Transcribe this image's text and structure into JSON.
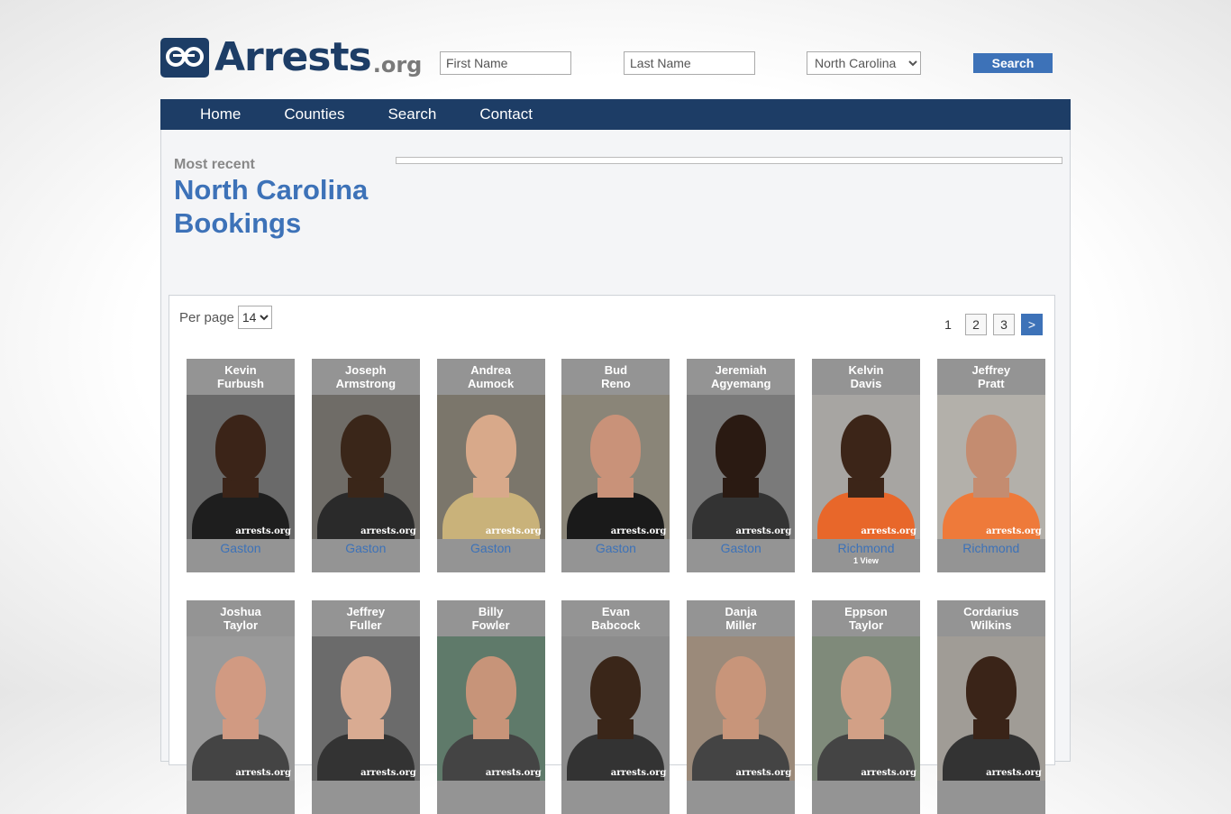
{
  "logo": {
    "text": "Arrests",
    "suffix": ".org"
  },
  "search": {
    "first_placeholder": "First Name",
    "last_placeholder": "Last Name",
    "state_selected": "North Carolina",
    "button_label": "Search"
  },
  "nav": [
    "Home",
    "Counties",
    "Search",
    "Contact"
  ],
  "heading": {
    "eyebrow": "Most recent",
    "title_line1": "North Carolina",
    "title_line2": "Bookings"
  },
  "list": {
    "per_page_label": "Per page",
    "per_page_value": "14",
    "pages": {
      "current": "1",
      "p2": "2",
      "p3": "3",
      "next": ">"
    },
    "watermark": "arrests.org",
    "bookings": [
      {
        "first": "Kevin",
        "last": "Furbush",
        "county": "Gaston",
        "views": "",
        "bg": "#6a6a6a",
        "skin": "#3b2418",
        "shirt": "#1e1e1e"
      },
      {
        "first": "Joseph",
        "last": "Armstrong",
        "county": "Gaston",
        "views": "",
        "bg": "#6f6c67",
        "skin": "#3a2619",
        "shirt": "#2a2a2a"
      },
      {
        "first": "Andrea",
        "last": "Aumock",
        "county": "Gaston",
        "views": "",
        "bg": "#7b766b",
        "skin": "#d8a98a",
        "shirt": "#c9b27a"
      },
      {
        "first": "Bud",
        "last": "Reno",
        "county": "Gaston",
        "views": "",
        "bg": "#8a8578",
        "skin": "#c99279",
        "shirt": "#1a1a1a"
      },
      {
        "first": "Jeremiah",
        "last": "Agyemang",
        "county": "Gaston",
        "views": "",
        "bg": "#7a7a7a",
        "skin": "#2a1a12",
        "shirt": "#333333"
      },
      {
        "first": "Kelvin",
        "last": "Davis",
        "county": "Richmond",
        "views": "1 View",
        "bg": "#a7a5a2",
        "skin": "#3c2518",
        "shirt": "#e8672a"
      },
      {
        "first": "Jeffrey",
        "last": "Pratt",
        "county": "Richmond",
        "views": "",
        "bg": "#b3b0aa",
        "skin": "#c48c70",
        "shirt": "#ee7a3a"
      },
      {
        "first": "Joshua",
        "last": "Taylor",
        "county": "",
        "views": "",
        "bg": "#9a9a9a",
        "skin": "#d19a82",
        "shirt": "#444444"
      },
      {
        "first": "Jeffrey",
        "last": "Fuller",
        "county": "",
        "views": "",
        "bg": "#6b6b6b",
        "skin": "#d9ab92",
        "shirt": "#333333"
      },
      {
        "first": "Billy",
        "last": "Fowler",
        "county": "",
        "views": "",
        "bg": "#5f7a6a",
        "skin": "#c79479",
        "shirt": "#444444"
      },
      {
        "first": "Evan",
        "last": "Babcock",
        "county": "",
        "views": "",
        "bg": "#8c8c8c",
        "skin": "#3a2619",
        "shirt": "#333333"
      },
      {
        "first": "Danja",
        "last": "Miller",
        "county": "",
        "views": "",
        "bg": "#9b8a7a",
        "skin": "#c8957a",
        "shirt": "#444444"
      },
      {
        "first": "Eppson",
        "last": "Taylor",
        "county": "",
        "views": "",
        "bg": "#7f8a7a",
        "skin": "#d2a086",
        "shirt": "#444444"
      },
      {
        "first": "Cordarius",
        "last": "Wilkins",
        "county": "",
        "views": "",
        "bg": "#a09c96",
        "skin": "#3a2418",
        "shirt": "#333333"
      }
    ]
  }
}
